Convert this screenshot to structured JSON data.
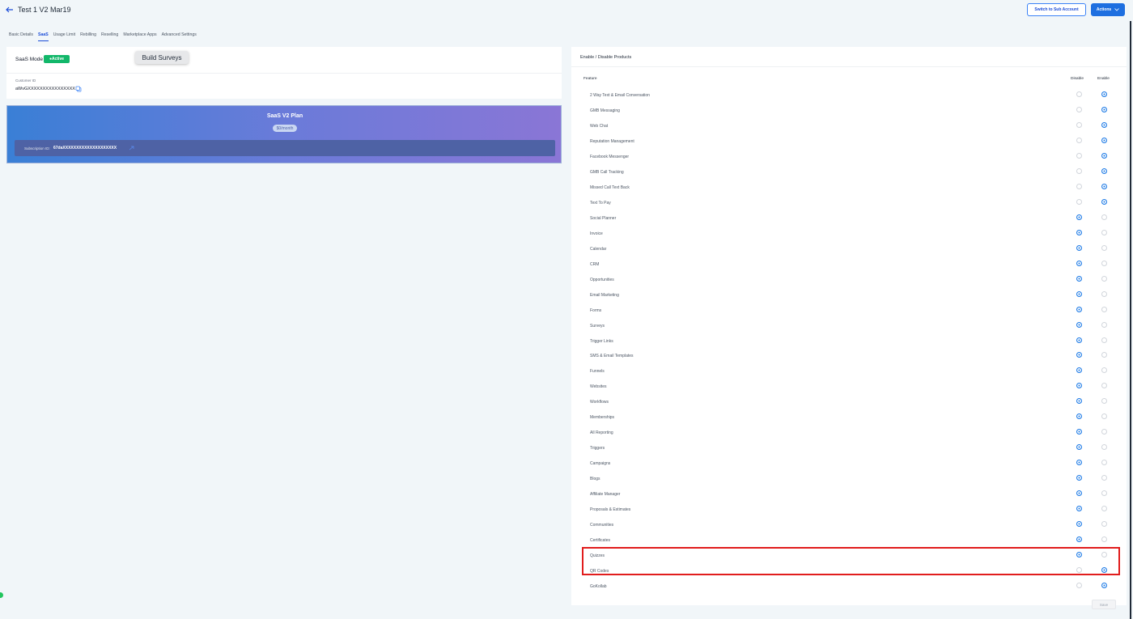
{
  "header": {
    "title": "Test 1 V2 Mar19",
    "switch_label": "Switch to Sub Account",
    "actions_label": "Actions"
  },
  "tabs": [
    {
      "label": "Basic Details",
      "active": false
    },
    {
      "label": "SaaS",
      "active": true
    },
    {
      "label": "Usage Limit",
      "active": false
    },
    {
      "label": "Rebilling",
      "active": false
    },
    {
      "label": "Reselling",
      "active": false
    },
    {
      "label": "Marketplace Apps",
      "active": false
    },
    {
      "label": "Advanced Settings",
      "active": false
    }
  ],
  "saas": {
    "mode_label": "SaaS Mode",
    "status": "Active",
    "customer_id_label": "Customer ID",
    "customer_id": "aWvGXXXXXXXXXXXXXXXX",
    "tooltip": "Build Surveys"
  },
  "plan": {
    "name": "SaaS V2 Plan",
    "price": "$0/month",
    "subscription_label": "Subscription ID:",
    "subscription_id": "67daXXXXXXXXXXXXXXXXXXXX"
  },
  "products": {
    "title": "Enable / Disable Products",
    "col_feature": "Feature",
    "col_disable": "Disable",
    "col_enable": "Enable",
    "save_label": "Save",
    "items": [
      {
        "name": "2 Way Text & Email Conversation",
        "enabled": true
      },
      {
        "name": "GMB Messaging",
        "enabled": true
      },
      {
        "name": "Web Chat",
        "enabled": true
      },
      {
        "name": "Reputation Management",
        "enabled": true
      },
      {
        "name": "Facebook Messenger",
        "enabled": true
      },
      {
        "name": "GMB Call Tracking",
        "enabled": true
      },
      {
        "name": "Missed Call Text Back",
        "enabled": true
      },
      {
        "name": "Text To Pay",
        "enabled": true
      },
      {
        "name": "Social Planner",
        "enabled": false
      },
      {
        "name": "Invoice",
        "enabled": false
      },
      {
        "name": "Calendar",
        "enabled": false
      },
      {
        "name": "CRM",
        "enabled": false
      },
      {
        "name": "Opportunities",
        "enabled": false
      },
      {
        "name": "Email Marketing",
        "enabled": false
      },
      {
        "name": "Forms",
        "enabled": false
      },
      {
        "name": "Surveys",
        "enabled": false
      },
      {
        "name": "Trigger Links",
        "enabled": false
      },
      {
        "name": "SMS & Email Templates",
        "enabled": false
      },
      {
        "name": "Funnels",
        "enabled": false
      },
      {
        "name": "Websites",
        "enabled": false
      },
      {
        "name": "Workflows",
        "enabled": false
      },
      {
        "name": "Memberships",
        "enabled": false
      },
      {
        "name": "All Reporting",
        "enabled": false
      },
      {
        "name": "Triggers",
        "enabled": false
      },
      {
        "name": "Campaigns",
        "enabled": false
      },
      {
        "name": "Blogs",
        "enabled": false
      },
      {
        "name": "Affiliate Manager",
        "enabled": false
      },
      {
        "name": "Proposals & Estimates",
        "enabled": false
      },
      {
        "name": "Communities",
        "enabled": false
      },
      {
        "name": "Certificates",
        "enabled": false
      },
      {
        "name": "Quizzes",
        "enabled": false
      },
      {
        "name": "QR Codes",
        "enabled": true
      },
      {
        "name": "GoKollab",
        "enabled": true
      }
    ]
  },
  "colors": {
    "accent": "#1e7be6",
    "active_badge": "#12b76a",
    "highlight_border": "#e11d1d"
  }
}
